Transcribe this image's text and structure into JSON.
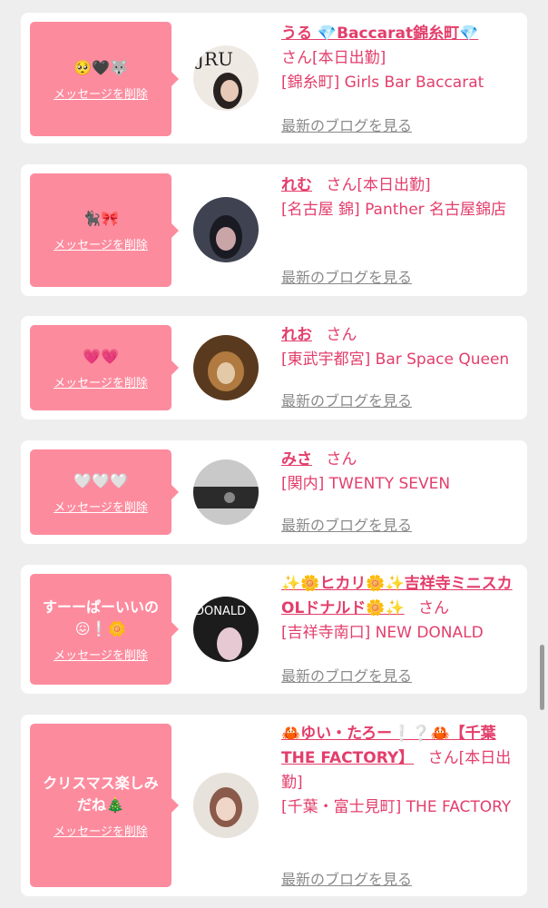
{
  "delete_label": "メッセージを削除",
  "blog_label": "最新のブログを見る",
  "san": "さん",
  "cards": [
    {
      "message": "🥺🖤🐺",
      "name": "うる 💎Baccarat錦糸町💎",
      "status": "[本日出勤]",
      "shop": "[錦糸町] Girls Bar Baccarat",
      "avatar_colors": [
        "#efe9e4",
        "#2a2220"
      ]
    },
    {
      "message": "🐈‍⬛🎀",
      "name": "れむ",
      "status": "[本日出勤]",
      "shop": "[名古屋 錦] Panther 名古屋錦店",
      "avatar_colors": [
        "#3f4250",
        "#c9a5a8"
      ]
    },
    {
      "message": "💗💗",
      "name": "れお",
      "status": "",
      "shop": "[東武宇都宮] Bar Space Queen",
      "avatar_colors": [
        "#5a3a1e",
        "#b07a40"
      ]
    },
    {
      "message": "🤍🤍🤍",
      "name": "みさ",
      "status": "",
      "shop": "[関内] TWENTY SEVEN",
      "avatar_colors": [
        "#c9c9c9",
        "#2b2b2b"
      ]
    },
    {
      "message": "すーーぱーいいの\n😖❕🌼",
      "name": "✨🌼ヒカリ🌼✨吉祥寺ミニスカOLドナルド🌼✨",
      "status": "",
      "shop": "[吉祥寺南口] NEW DONALD",
      "avatar_colors": [
        "#1c1c1c",
        "#e6c9d2"
      ]
    },
    {
      "message": "クリスマス楽しみ\nだね🎄",
      "name": "🦀ゆい・たろー❕❔🦀【千葉THE FACTORY】",
      "status": "[本日出勤]",
      "shop": "[千葉・富士見町] THE FACTORY",
      "avatar_colors": [
        "#e8e2dc",
        "#8a5a4a"
      ]
    }
  ]
}
